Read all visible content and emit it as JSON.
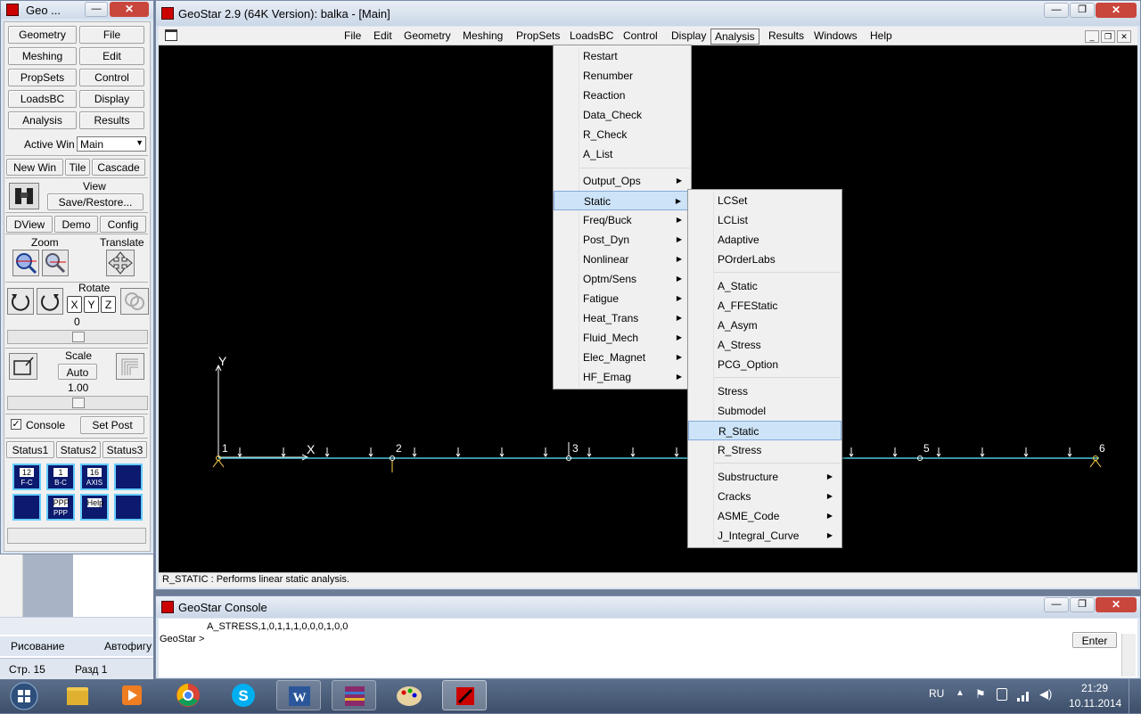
{
  "left_panel": {
    "title": "Geo ...",
    "buttons": [
      "Geometry",
      "File",
      "Meshing",
      "Edit",
      "PropSets",
      "Control",
      "LoadsBC",
      "Display",
      "Analysis",
      "Results"
    ],
    "active_win_label": "Active Win",
    "active_win_value": "Main",
    "win_buttons": [
      "New Win",
      "Tile",
      "Cascade"
    ],
    "view_label": "View",
    "save_restore": "Save/Restore...",
    "view_buttons": [
      "DView",
      "Demo",
      "Config"
    ],
    "zoom_label": "Zoom",
    "translate_label": "Translate",
    "rotate_label": "Rotate",
    "axes": [
      "X",
      "Y",
      "Z"
    ],
    "rotate_value": "0",
    "scale_label": "Scale",
    "scale_auto": "Auto",
    "scale_value": "1.00",
    "console_label": "Console",
    "console_checked": true,
    "set_post": "Set Post",
    "status_buttons": [
      "Status1",
      "Status2",
      "Status3"
    ],
    "tool_icons": [
      {
        "name": "fc-icon",
        "top": "12",
        "bottom": "F-C"
      },
      {
        "name": "bc-icon",
        "top": "1",
        "bottom": "B-C"
      },
      {
        "name": "axis-icon",
        "top": "16",
        "bottom": "AXIS"
      },
      {
        "name": "list-icon",
        "top": "",
        "bottom": ""
      },
      {
        "name": "hand-icon",
        "top": "",
        "bottom": ""
      },
      {
        "name": "ppp-icon",
        "top": "PPP",
        "bottom": "PPP"
      },
      {
        "name": "help-icon",
        "top": "Help",
        "bottom": ""
      },
      {
        "name": "graph-icon",
        "top": "",
        "bottom": ""
      }
    ]
  },
  "main_window": {
    "title": "GeoStar 2.9 (64K Version): balka - [Main]",
    "menu": [
      "File",
      "Edit",
      "Geometry",
      "Meshing",
      "PropSets",
      "LoadsBC",
      "Control",
      "Display",
      "Analysis",
      "Results",
      "Windows",
      "Help"
    ],
    "active_menu": "Analysis",
    "status_text": "R_STATIC : Performs linear static analysis."
  },
  "analysis_menu": {
    "items": [
      "Restart",
      "Renumber",
      "Reaction",
      "Data_Check",
      "R_Check",
      "A_List",
      "Output_Ops",
      "Static",
      "Freq/Buck",
      "Post_Dyn",
      "Nonlinear",
      "Optm/Sens",
      "Fatigue",
      "Heat_Trans",
      "Fluid_Mech",
      "Elec_Magnet",
      "HF_Emag"
    ],
    "submenu_items": [
      "Output_Ops",
      "Static",
      "Freq/Buck",
      "Post_Dyn",
      "Nonlinear",
      "Optm/Sens",
      "Fatigue",
      "Heat_Trans",
      "Fluid_Mech",
      "Elec_Magnet",
      "HF_Emag"
    ],
    "highlighted": "Static"
  },
  "static_menu": {
    "groups": [
      [
        "LCSet",
        "LCList",
        "Adaptive",
        "POrderLabs"
      ],
      [
        "A_Static",
        "A_FFEStatic",
        "A_Asym",
        "A_Stress",
        "PCG_Option"
      ],
      [
        "Stress",
        "Submodel",
        "R_Static",
        "R_Stress"
      ],
      [
        "Substructure",
        "Cracks",
        "ASME_Code",
        "J_Integral_Curve"
      ]
    ],
    "submenu_items": [
      "Substructure",
      "Cracks",
      "ASME_Code",
      "J_Integral_Curve"
    ],
    "highlighted": "R_Static"
  },
  "viewport": {
    "axis_y": "Y",
    "axis_x": "X",
    "nodes": [
      "1",
      "2",
      "3",
      "4",
      "5",
      "6"
    ]
  },
  "console": {
    "title": "GeoStar Console",
    "output": "A_STRESS,1,0,1,1,1,0,0,0,1,0,0",
    "prompt": "GeoStar >",
    "enter": "Enter"
  },
  "word_bg": {
    "drawing": "Рисование",
    "autoshapes": "Автофигу",
    "page": "Стр. 15",
    "section": "Разд 1"
  },
  "taskbar": {
    "lang": "RU",
    "time": "21:29",
    "date": "10.11.2014"
  },
  "colors": {
    "beam": "#4fc6d8",
    "load": "#ffffff",
    "node_support": "#ffd24a",
    "highlight": "#cde3f7"
  }
}
